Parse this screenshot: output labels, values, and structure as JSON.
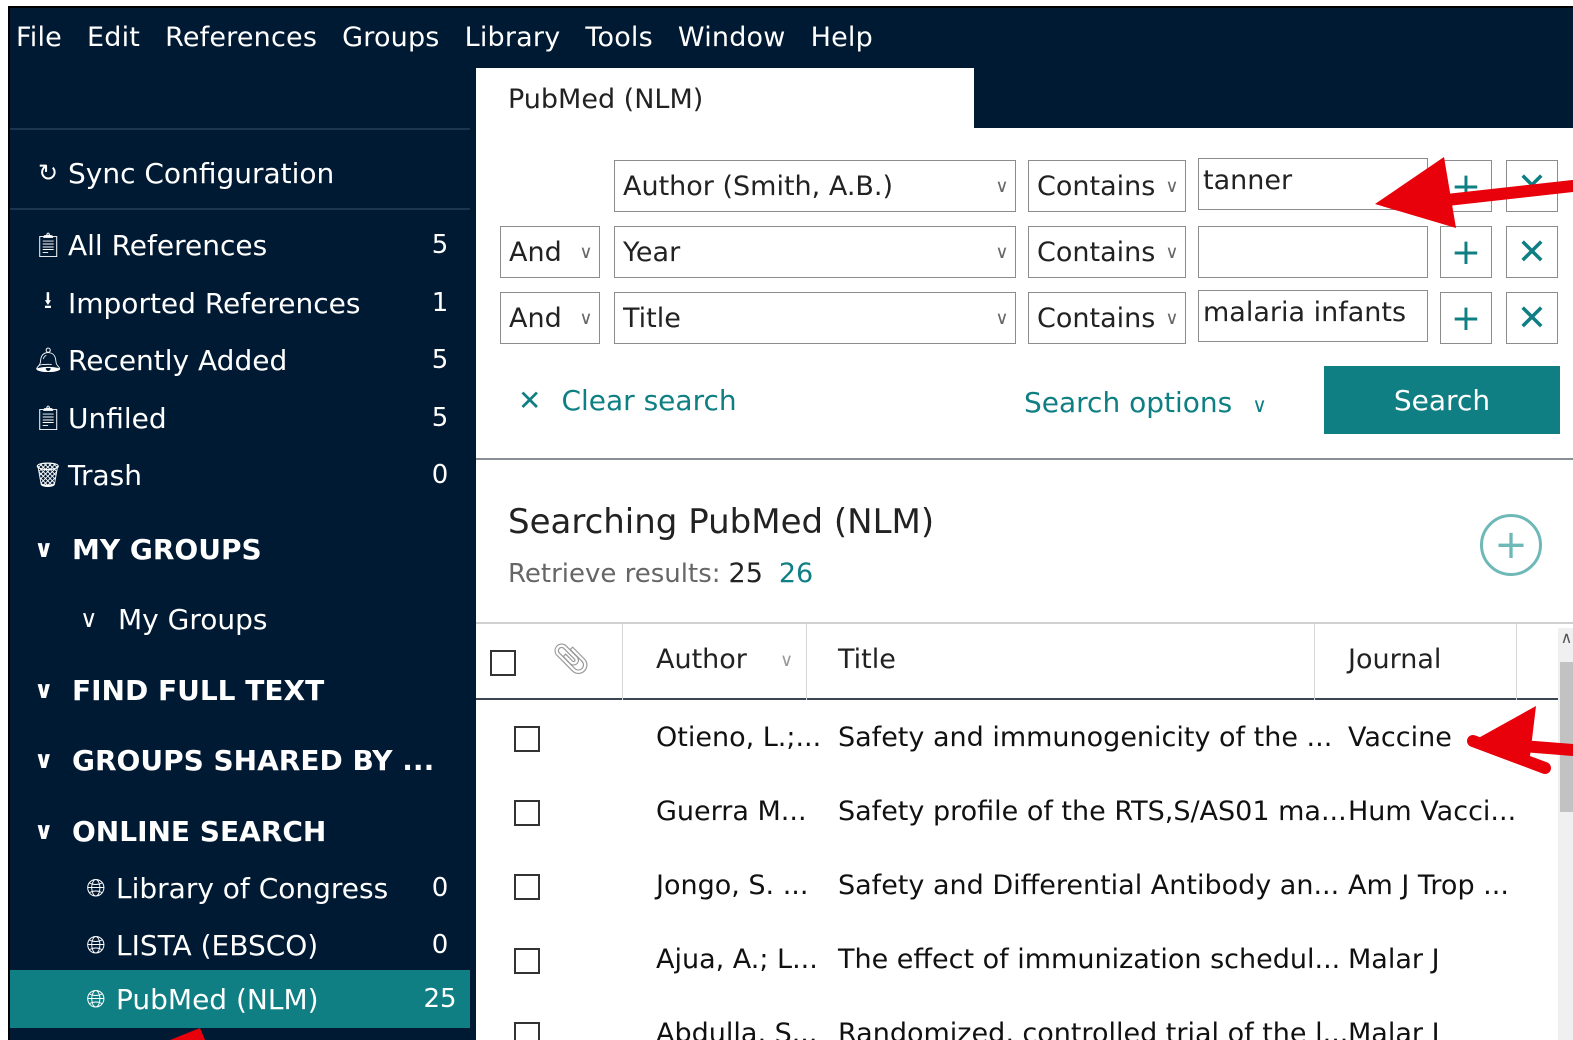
{
  "menu": [
    "File",
    "Edit",
    "References",
    "Groups",
    "Library",
    "Tools",
    "Window",
    "Help"
  ],
  "sidebar": {
    "sync_label": "Sync Configuration",
    "library_items": [
      {
        "label": "All References",
        "count": "5",
        "icon": "clipboard-icon"
      },
      {
        "label": "Imported References",
        "count": "1",
        "icon": "import-icon"
      },
      {
        "label": "Recently Added",
        "count": "5",
        "icon": "bell-icon"
      },
      {
        "label": "Unfiled",
        "count": "5",
        "icon": "clipboard-icon"
      },
      {
        "label": "Trash",
        "count": "0",
        "icon": "trash-icon"
      }
    ],
    "sections": {
      "my_groups": "MY GROUPS",
      "my_groups_sub": "My Groups",
      "find_full_text": "FIND FULL TEXT",
      "groups_shared": "GROUPS SHARED BY ...",
      "online_search": "ONLINE SEARCH"
    },
    "online_items": [
      {
        "label": "Library of Congress",
        "count": "0",
        "icon": "globe-icon"
      },
      {
        "label": "LISTA (EBSCO)",
        "count": "0",
        "icon": "globe-icon"
      },
      {
        "label": "PubMed (NLM)",
        "count": "25",
        "icon": "globe-icon"
      }
    ]
  },
  "tab": {
    "label": "PubMed (NLM)"
  },
  "search": {
    "rows": [
      {
        "bool": "",
        "field": "Author (Smith, A.B.)",
        "op": "Contains",
        "value": "tanner"
      },
      {
        "bool": "And",
        "field": "Year",
        "op": "Contains",
        "value": ""
      },
      {
        "bool": "And",
        "field": "Title",
        "op": "Contains",
        "value": "malaria infants"
      }
    ],
    "clear_label": "Clear search",
    "options_label": "Search options",
    "search_label": "Search"
  },
  "results": {
    "title": "Searching PubMed (NLM)",
    "retrieve_label": "Retrieve results:",
    "retrieve_count": "25",
    "retrieve_total": "26"
  },
  "table": {
    "columns": [
      "Author",
      "Title",
      "Journal"
    ],
    "rows": [
      {
        "author": "Otieno, L.;...",
        "title": "Safety and immunogenicity of the ...",
        "journal": "Vaccine"
      },
      {
        "author": "Guerra M...",
        "title": "Safety profile of the RTS,S/AS01 ma...",
        "journal": "Hum Vacci..."
      },
      {
        "author": "Jongo, S. ...",
        "title": "Safety and Differential Antibody an...",
        "journal": "Am J Trop ..."
      },
      {
        "author": "Ajua, A.; L...",
        "title": "The effect of immunization schedul...",
        "journal": "Malar J"
      },
      {
        "author": "Abdulla, S...",
        "title": "Randomized, controlled trial of the l...",
        "journal": "Malar J"
      }
    ]
  },
  "colors": {
    "accent": "#0f7f84",
    "sidebar_bg": "#001a33",
    "arrow": "#e8000b"
  }
}
